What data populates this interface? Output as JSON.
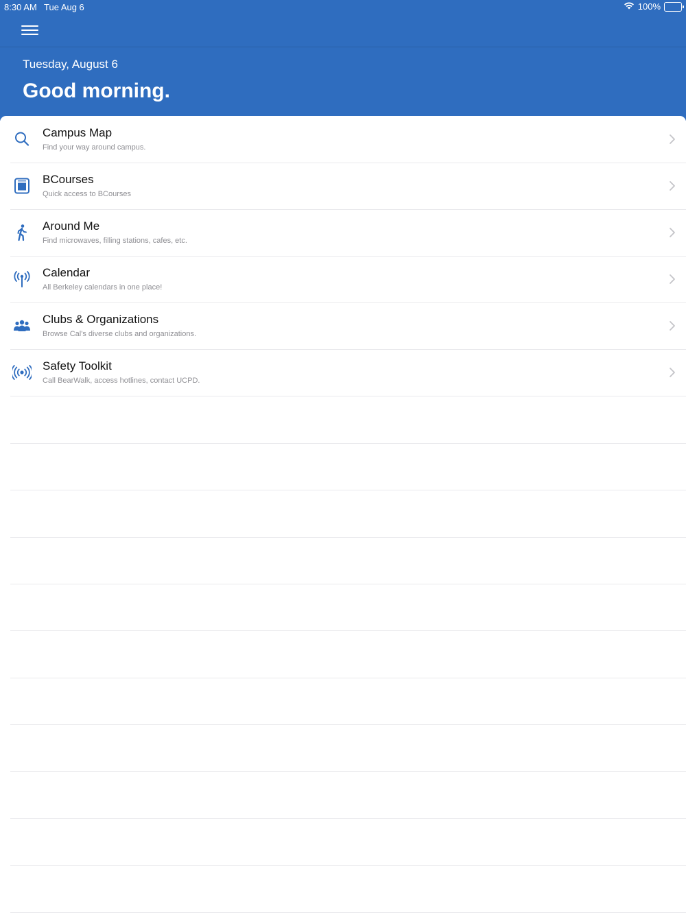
{
  "status_bar": {
    "time": "8:30 AM",
    "date": "Tue Aug 6",
    "battery": "100%"
  },
  "header": {
    "date": "Tuesday, August 6",
    "greeting": "Good morning."
  },
  "menu": [
    {
      "title": "Campus Map",
      "subtitle": "Find your way around campus.",
      "icon": "search-icon"
    },
    {
      "title": "BCourses",
      "subtitle": "Quick access to BCourses",
      "icon": "bcourses-icon"
    },
    {
      "title": "Around Me",
      "subtitle": "Find microwaves, filling stations, cafes, etc.",
      "icon": "walking-person-icon"
    },
    {
      "title": "Calendar",
      "subtitle": "All Berkeley calendars in one place!",
      "icon": "antenna-icon"
    },
    {
      "title": "Clubs & Organizations",
      "subtitle": "Browse Cal's diverse clubs and organizations.",
      "icon": "group-icon"
    },
    {
      "title": "Safety Toolkit",
      "subtitle": "Call BearWalk, access hotlines, contact UCPD.",
      "icon": "broadcast-icon"
    }
  ],
  "colors": {
    "header_blue": "#2f6dbf",
    "icon_blue": "#2f6dbf",
    "subtitle_gray": "#8e8e93",
    "separator": "#e9e9ec"
  }
}
